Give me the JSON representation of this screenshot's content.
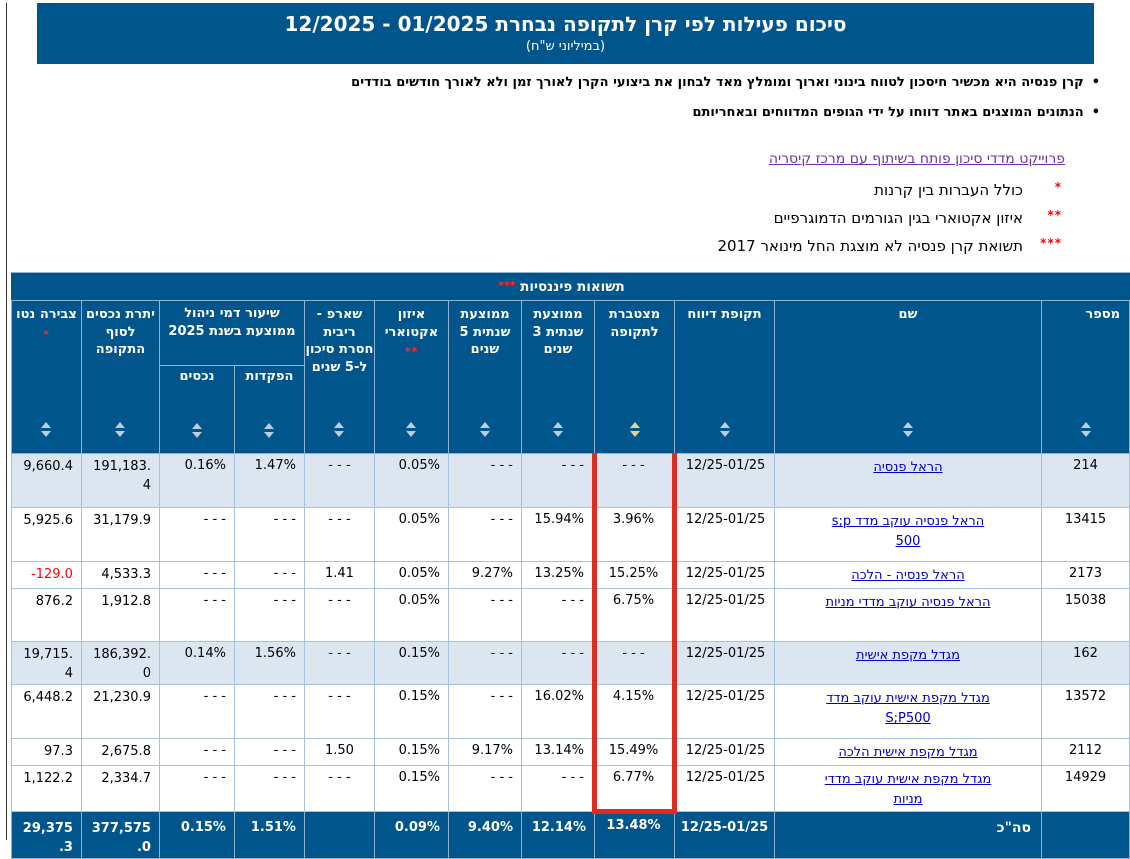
{
  "header": {
    "title": "סיכום פעילות לפי קרן לתקופה נבחרת 01/2025 - 12/2025",
    "subtitle": "(במיליוני ש\"ח)"
  },
  "notes": {
    "bullets": [
      "קרן פנסיה היא מכשיר חיסכון לטווח בינוני וארוך ומומלץ מאד לבחון את ביצועי הקרן לאורך זמן ולא לאורך חודשים בודדים",
      "הנתונים המוצגים באתר דווחו על ידי הגופים המדווחים ובאחריותם"
    ],
    "link": "פרוייקט מדדי סיכון פותח בשיתוף עם מרכז קיסריה",
    "footnotes": [
      {
        "marker": "*",
        "text": "כולל העברות בין קרנות"
      },
      {
        "marker": "**",
        "text": "איזון אקטוארי בגין הגורמים הדמוגרפיים"
      },
      {
        "marker": "***",
        "text": "תשואת קרן פנסיה לא מוצגת החל מינואר 2017"
      }
    ]
  },
  "table": {
    "columns": {
      "number": "מספר",
      "name": "שם",
      "report_period": "תקופת דיווח",
      "financial_returns_group": "תשואות פיננסיות",
      "financial_returns_marker": "***",
      "cumulative": "מצטברת לתקופה",
      "avg3": "ממוצעת שנתית 3 שנים",
      "avg5": "ממוצעת שנתית 5 שנים",
      "actuarial": "איזון אקטוארי",
      "actuarial_marker": "**",
      "sharpe": "שארפ - ריבית חסרת סיכון ל-5 שנים",
      "fees_group": "שיעור דמי ניהול ממוצעת בשנת 2025",
      "fee_deposits": "הפקדות",
      "fee_assets": "נכסים",
      "assets_end": "יתרת נכסים לסוף התקופה",
      "net_accum": "צבירה נטו",
      "net_accum_marker": "*"
    },
    "rows": [
      {
        "number": "214",
        "name": "הראל פנסיה",
        "period": "12/25-01/25",
        "cumulative": "- - -",
        "avg3": "- - -",
        "avg5": "- - -",
        "actuarial": "0.05%",
        "sharpe": "- - -",
        "fee_deposits": "1.47%",
        "fee_assets": "0.16%",
        "assets_end": "191,183.4",
        "net_accum": "9,660.4"
      },
      {
        "number": "13415",
        "name": "הראל פנסיה עוקב מדד s;p 500",
        "period": "12/25-01/25",
        "cumulative": "3.96%",
        "avg3": "15.94%",
        "avg5": "- - -",
        "actuarial": "0.05%",
        "sharpe": "- - -",
        "fee_deposits": "- - -",
        "fee_assets": "- - -",
        "assets_end": "31,179.9",
        "net_accum": "5,925.6"
      },
      {
        "number": "2173",
        "name": "הראל פנסיה - הלכה",
        "period": "12/25-01/25",
        "cumulative": "15.25%",
        "avg3": "13.25%",
        "avg5": "9.27%",
        "actuarial": "0.05%",
        "sharpe": "1.41",
        "fee_deposits": "- - -",
        "fee_assets": "- - -",
        "assets_end": "4,533.3",
        "net_accum": "-129.0"
      },
      {
        "number": "15038",
        "name": "הראל פנסיה עוקב מדדי מניות",
        "period": "12/25-01/25",
        "cumulative": "6.75%",
        "avg3": "- - -",
        "avg5": "- - -",
        "actuarial": "0.05%",
        "sharpe": "- - -",
        "fee_deposits": "- - -",
        "fee_assets": "- - -",
        "assets_end": "1,912.8",
        "net_accum": "876.2"
      },
      {
        "number": "162",
        "name": "מגדל מקפת אישית",
        "period": "12/25-01/25",
        "cumulative": "- - -",
        "avg3": "- - -",
        "avg5": "- - -",
        "actuarial": "0.15%",
        "sharpe": "- - -",
        "fee_deposits": "1.56%",
        "fee_assets": "0.14%",
        "assets_end": "186,392.0",
        "net_accum": "19,715.4"
      },
      {
        "number": "13572",
        "name": "מגדל מקפת אישית עוקב מדד S;P500",
        "period": "12/25-01/25",
        "cumulative": "4.15%",
        "avg3": "16.02%",
        "avg5": "- - -",
        "actuarial": "0.15%",
        "sharpe": "- - -",
        "fee_deposits": "- - -",
        "fee_assets": "- - -",
        "assets_end": "21,230.9",
        "net_accum": "6,448.2"
      },
      {
        "number": "2112",
        "name": "מגדל מקפת אישית הלכה",
        "period": "12/25-01/25",
        "cumulative": "15.49%",
        "avg3": "13.14%",
        "avg5": "9.17%",
        "actuarial": "0.15%",
        "sharpe": "1.50",
        "fee_deposits": "- - -",
        "fee_assets": "- - -",
        "assets_end": "2,675.8",
        "net_accum": "97.3"
      },
      {
        "number": "14929",
        "name": "מגדל מקפת אישית עוקב מדדי מניות",
        "period": "12/25-01/25",
        "cumulative": "6.77%",
        "avg3": "- - -",
        "avg5": "- - -",
        "actuarial": "0.15%",
        "sharpe": "- - -",
        "fee_deposits": "- - -",
        "fee_assets": "- - -",
        "assets_end": "2,334.7",
        "net_accum": "1,122.2"
      }
    ],
    "totals": {
      "label": "סה\"כ",
      "period": "12/25-01/25",
      "cumulative": "13.48%",
      "avg3": "12.14%",
      "avg5": "9.40%",
      "actuarial": "0.09%",
      "fee_deposits": "1.51%",
      "fee_assets": "0.15%",
      "assets_end": "377,575.0",
      "net_accum": "29,375.3"
    }
  },
  "colors": {
    "header_blue": "#00568C",
    "alt_row_blue": "#DCE6F1",
    "highlight_border_red": "#E02B20",
    "highlight_header_green": "#4A7A6C",
    "highlight_cell_yellow": "#FBF4CD",
    "footnote_red": "#FF0000",
    "visited_link_purple": "#7130A8",
    "fund_link_blue": "#0000CC"
  }
}
